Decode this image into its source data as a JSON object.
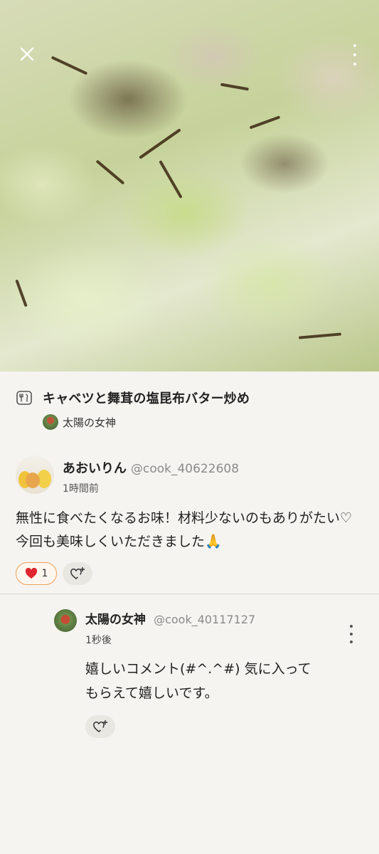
{
  "recipe": {
    "title": "キャベツと舞茸の塩昆布バター炒め",
    "author": "太陽の女神"
  },
  "comment": {
    "name": "あおいりん",
    "handle": "@cook_40622608",
    "time": "1時間前",
    "body": "無性に食べたくなるお味！材料少ないのもありがたい♡今回も美味しくいただきました🙏",
    "like_count": "1"
  },
  "reply": {
    "name": "太陽の女神",
    "handle": "@cook_40117127",
    "time": "1秒後",
    "body": "嬉しいコメント(#^.^#) 気に入ってもらえて嬉しいです。"
  },
  "colors": {
    "background": "#f5f4f0",
    "like_border": "#f0a055",
    "heart": "#e0262f"
  },
  "icons": [
    "close-icon",
    "more-vertical-icon",
    "recipe-icon",
    "heart-icon",
    "add-reaction-icon"
  ]
}
